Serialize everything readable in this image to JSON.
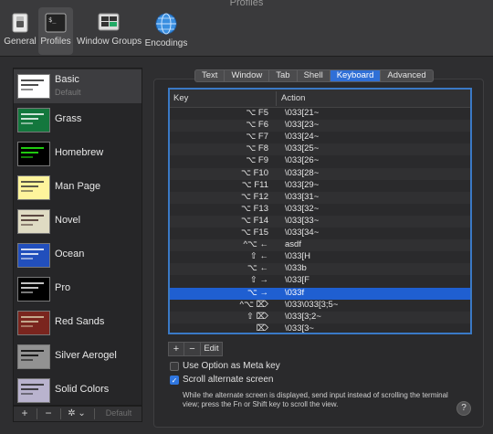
{
  "window": {
    "title": "Profiles"
  },
  "toolbar": [
    {
      "label": "General",
      "icon": "general-switch-icon"
    },
    {
      "label": "Profiles",
      "icon": "terminal-profile-icon",
      "selected": true
    },
    {
      "label": "Window Groups",
      "icon": "window-groups-icon"
    },
    {
      "label": "Encodings",
      "icon": "globe-icon"
    }
  ],
  "profiles": [
    {
      "name": "Basic",
      "sub": "Default",
      "bg": "#ffffff",
      "fg": "#222222",
      "selected": true
    },
    {
      "name": "Grass",
      "bg": "#13773d",
      "fg": "#ffffff"
    },
    {
      "name": "Homebrew",
      "bg": "#000000",
      "fg": "#28fe14"
    },
    {
      "name": "Man Page",
      "bg": "#fef49c",
      "fg": "#333333"
    },
    {
      "name": "Novel",
      "bg": "#dfdbc3",
      "fg": "#3b2322"
    },
    {
      "name": "Ocean",
      "bg": "#224fbc",
      "fg": "#ffffff"
    },
    {
      "name": "Pro",
      "bg": "#000000",
      "fg": "#f2f2f2"
    },
    {
      "name": "Red Sands",
      "bg": "#7a251e",
      "fg": "#d7c9a7"
    },
    {
      "name": "Silver Aerogel",
      "bg": "#929292",
      "fg": "#000000"
    },
    {
      "name": "Solid Colors",
      "bg": "#b9b3ce",
      "fg": "#222222"
    }
  ],
  "sidebar_footer": {
    "add": "+",
    "remove": "−",
    "gear": "✲ ⌄",
    "default": "Default"
  },
  "tabs": [
    {
      "label": "Text"
    },
    {
      "label": "Window"
    },
    {
      "label": "Tab"
    },
    {
      "label": "Shell"
    },
    {
      "label": "Keyboard",
      "active": true
    },
    {
      "label": "Advanced"
    }
  ],
  "table": {
    "headers": {
      "key": "Key",
      "action": "Action"
    },
    "rows": [
      {
        "key": "⌥ F5",
        "action": "\\033[21~"
      },
      {
        "key": "⌥ F6",
        "action": "\\033[23~"
      },
      {
        "key": "⌥ F7",
        "action": "\\033[24~"
      },
      {
        "key": "⌥ F8",
        "action": "\\033[25~"
      },
      {
        "key": "⌥ F9",
        "action": "\\033[26~"
      },
      {
        "key": "⌥ F10",
        "action": "\\033[28~"
      },
      {
        "key": "⌥ F11",
        "action": "\\033[29~"
      },
      {
        "key": "⌥ F12",
        "action": "\\033[31~"
      },
      {
        "key": "⌥ F13",
        "action": "\\033[32~"
      },
      {
        "key": "⌥ F14",
        "action": "\\033[33~"
      },
      {
        "key": "⌥ F15",
        "action": "\\033[34~"
      },
      {
        "key": "^⌥ ←",
        "action": "asdf"
      },
      {
        "key": "⇧ ←",
        "action": "\\033[H"
      },
      {
        "key": "⌥ ←",
        "action": "\\033b"
      },
      {
        "key": "⇧ →",
        "action": "\\033[F"
      },
      {
        "key": "⌥ →",
        "action": "\\033f",
        "selected": true
      },
      {
        "key": "^⌥ ⌦",
        "action": "\\033\\033[3;5~"
      },
      {
        "key": "⇧ ⌦",
        "action": "\\033[3;2~"
      },
      {
        "key": "⌦",
        "action": "\\033[3~"
      }
    ]
  },
  "table_buttons": {
    "add": "+",
    "remove": "−",
    "edit": "Edit"
  },
  "options": [
    {
      "label": "Use Option as Meta key",
      "checked": false
    },
    {
      "label": "Scroll alternate screen",
      "checked": true
    }
  ],
  "note": "While the alternate screen is displayed, send input instead of scrolling the terminal view; press the Fn or Shift key to scroll the view.",
  "help": "?"
}
